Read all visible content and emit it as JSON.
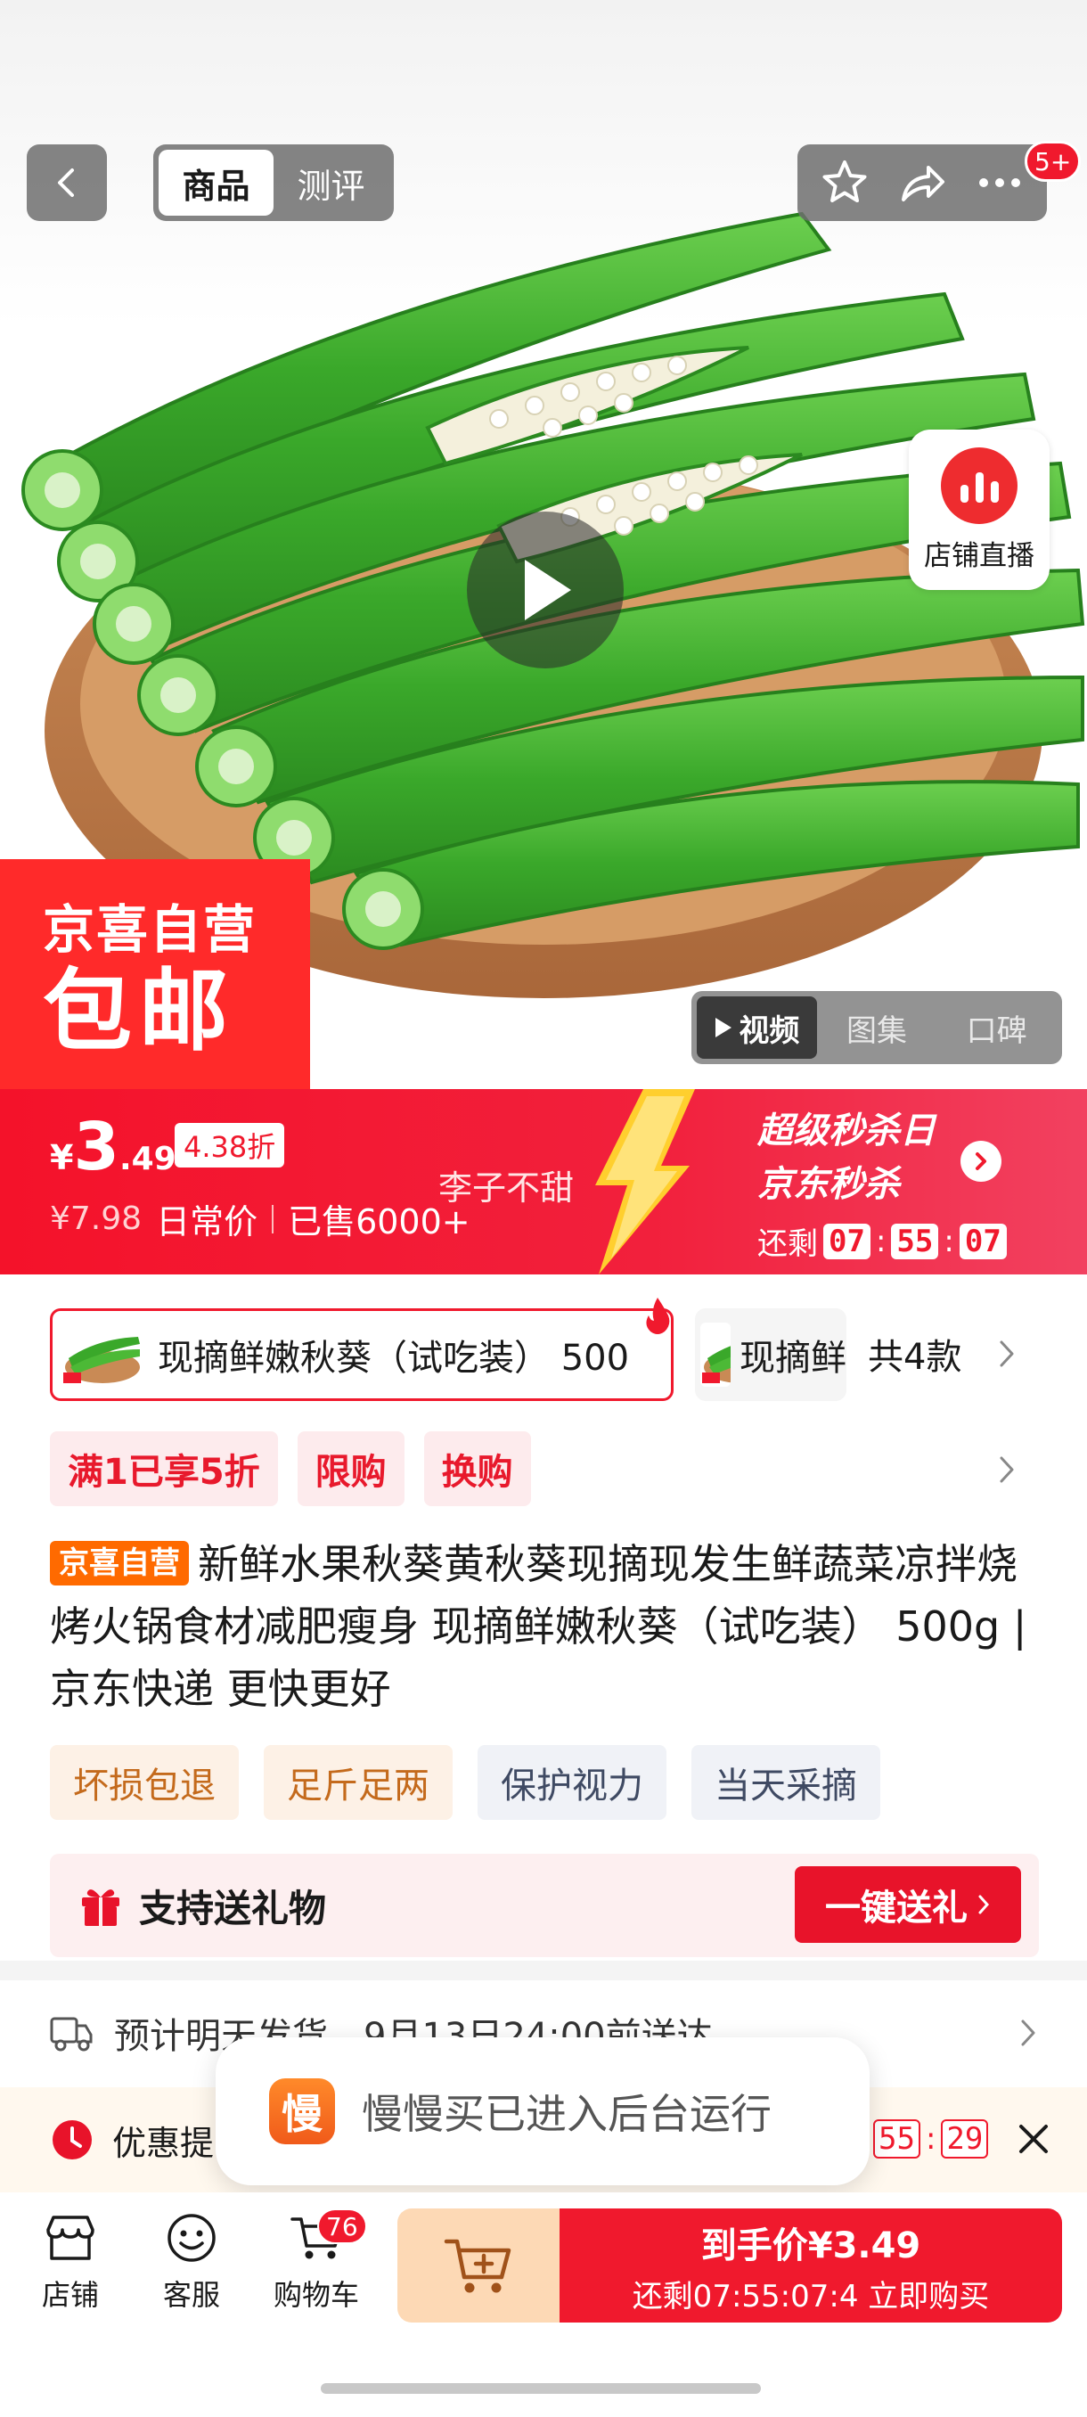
{
  "header": {
    "tab_product": "商品",
    "tab_review": "测评",
    "more_badge": "5+"
  },
  "hero": {
    "live_label": "店铺直播",
    "promo_line1": "京喜自营",
    "promo_line2": "包邮",
    "media_tabs": [
      "视频",
      "图集",
      "口碑"
    ]
  },
  "price": {
    "currency": "¥",
    "int": "3",
    "dec": ".49",
    "discount": "4.38折",
    "original": "¥7.98",
    "daily_label": "日常价",
    "sold": "已售6000+",
    "shop": "李子不甜"
  },
  "seckill": {
    "line1": "超级秒杀日",
    "line2": "京东秒杀",
    "remain_label": "还剩",
    "h": "07",
    "m": "55",
    "s": "07"
  },
  "spec": {
    "selected": "现摘鲜嫩秋葵（试吃装） 500",
    "other": "现摘鲜",
    "total": "共4款"
  },
  "offers": [
    "满1已享5折",
    "限购",
    "换购"
  ],
  "title": {
    "tag": "京喜自营",
    "text": "新鲜水果秋葵黄秋葵现摘现发生鲜蔬菜凉拌烧烤火锅食材减肥瘦身 现摘鲜嫩秋葵（试吃装） 500g | 京东快递 更快更好"
  },
  "features": {
    "warm": [
      "坏损包退",
      "足斤足两"
    ],
    "cool": [
      "保护视力",
      "当天采摘"
    ]
  },
  "gift": {
    "label": "支持送礼物",
    "button": "一键送礼"
  },
  "shipping": {
    "text": "预计明天发货，9月13日24:00前送达"
  },
  "reminder": {
    "text": "优惠提",
    "m": "55",
    "s": "29"
  },
  "toast": {
    "icon_char": "慢",
    "text": "慢慢买已进入后台运行"
  },
  "bottom": {
    "store": "店铺",
    "service": "客服",
    "cart": "购物车",
    "cart_count": "76",
    "buy_line1": "到手价¥3.49",
    "buy_line2": "还剩07:55:07:4  立即购买"
  },
  "colors": {
    "brand_red": "#f0192d",
    "orange_tag": "#ff6a00"
  }
}
